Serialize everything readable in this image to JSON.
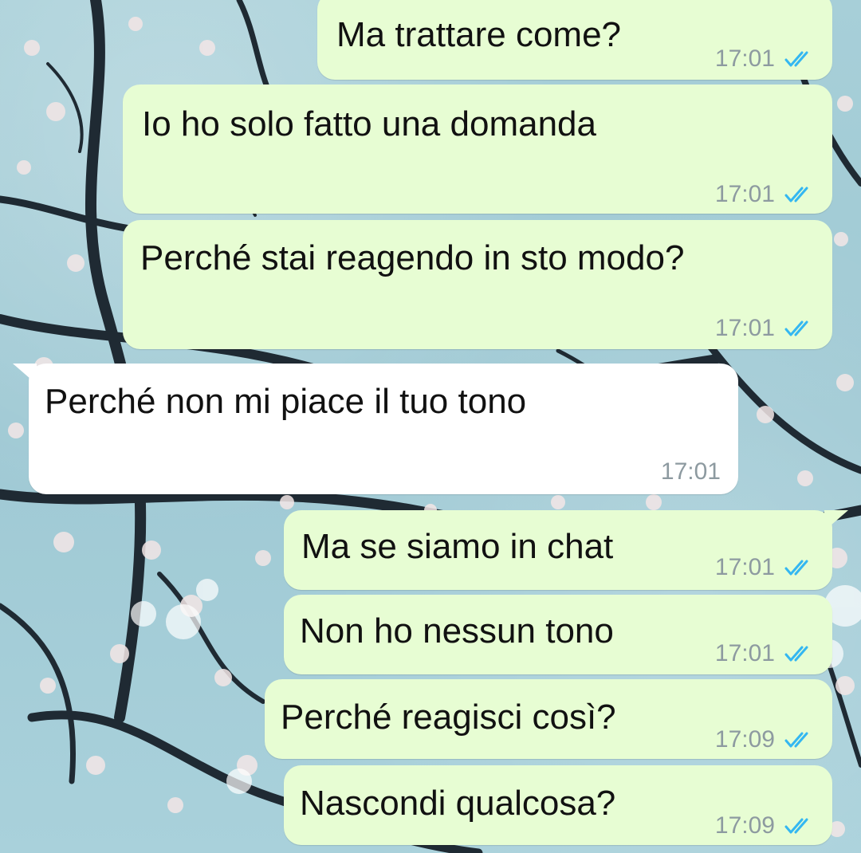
{
  "theme": {
    "outgoing_bubble": "#e7fdd3",
    "incoming_bubble": "#ffffff",
    "read_tick_color": "#34b7f1",
    "timestamp_color": "#8d9aa0"
  },
  "messages": [
    {
      "direction": "outgoing",
      "text": "Ma trattare come?",
      "time": "17:01",
      "status": "read-double-tick-icon"
    },
    {
      "direction": "outgoing",
      "text": "Io ho solo fatto una domanda",
      "time": "17:01",
      "status": "read-double-tick-icon"
    },
    {
      "direction": "outgoing",
      "text": "Perché stai reagendo in sto modo?",
      "time": "17:01",
      "status": "read-double-tick-icon"
    },
    {
      "direction": "incoming",
      "text": "Perché non mi piace il tuo tono",
      "time": "17:01"
    },
    {
      "direction": "outgoing",
      "text": "Ma se siamo in chat",
      "time": "17:01",
      "status": "read-double-tick-icon"
    },
    {
      "direction": "outgoing",
      "text": "Non ho nessun tono",
      "time": "17:01",
      "status": "read-double-tick-icon"
    },
    {
      "direction": "outgoing",
      "text": "Perché reagisci così?",
      "time": "17:09",
      "status": "read-double-tick-icon"
    },
    {
      "direction": "outgoing",
      "text": "Nascondi qualcosa?",
      "time": "17:09",
      "status": "read-double-tick-icon"
    }
  ]
}
